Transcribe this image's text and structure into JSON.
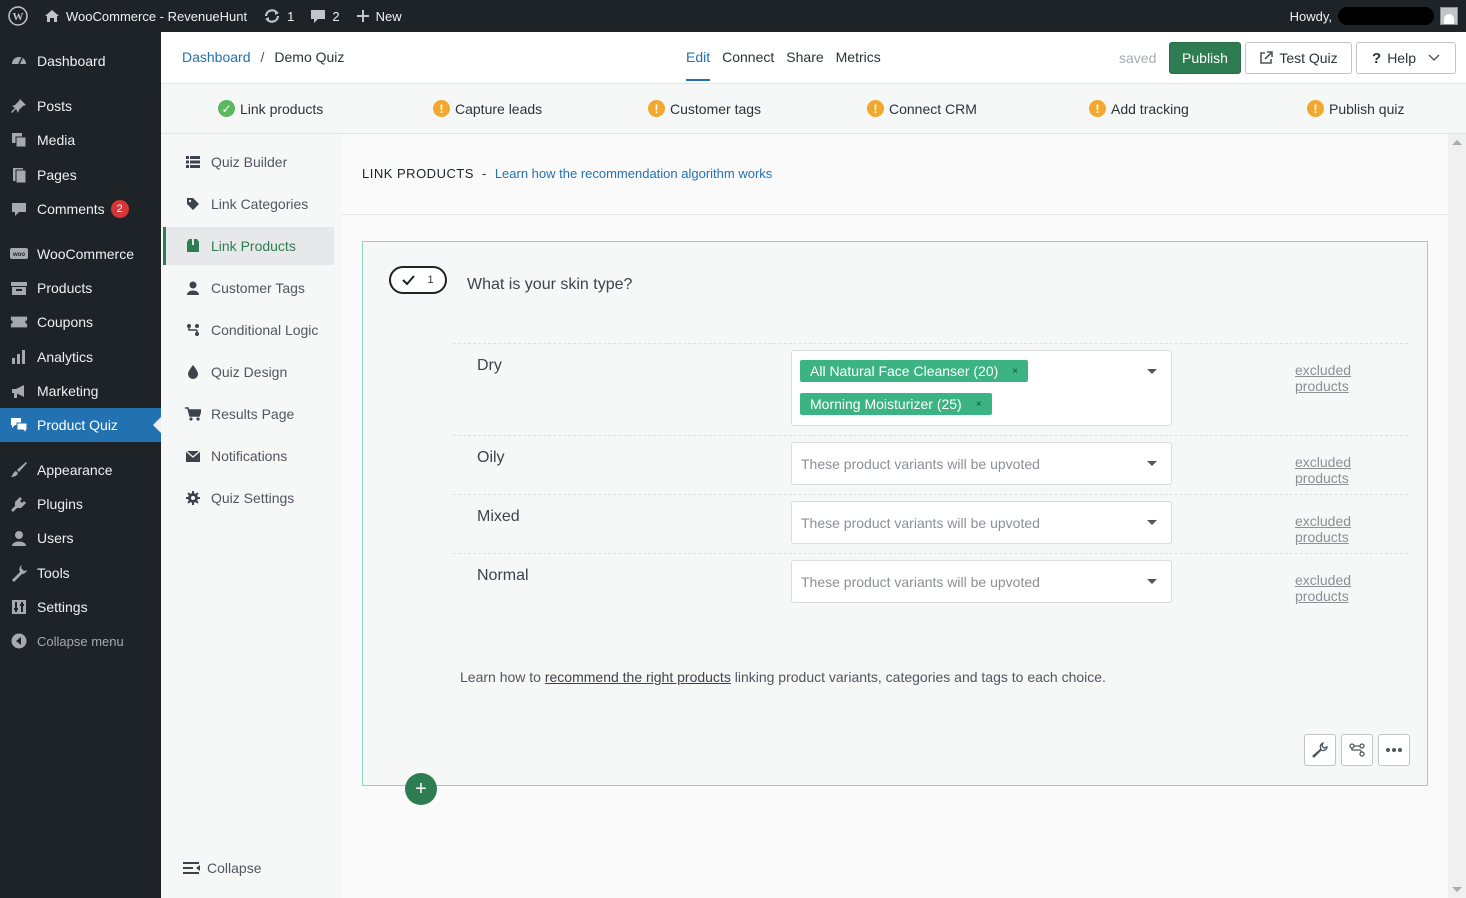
{
  "adminbar": {
    "site_name": "WooCommerce - RevenueHunt",
    "updates_count": "1",
    "comments_count": "2",
    "new_label": "New",
    "howdy": "Howdy,"
  },
  "menu": {
    "items": [
      {
        "label": "Dashboard",
        "icon": "dashboard-icon"
      },
      {
        "label": "Posts",
        "icon": "pin-icon"
      },
      {
        "label": "Media",
        "icon": "media-icon"
      },
      {
        "label": "Pages",
        "icon": "pages-icon"
      },
      {
        "label": "Comments",
        "icon": "comment-icon",
        "badge": "2"
      },
      {
        "label": "WooCommerce",
        "icon": "woo-icon"
      },
      {
        "label": "Products",
        "icon": "archive-icon"
      },
      {
        "label": "Coupons",
        "icon": "ticket-icon"
      },
      {
        "label": "Analytics",
        "icon": "chart-icon"
      },
      {
        "label": "Marketing",
        "icon": "megaphone-icon"
      },
      {
        "label": "Product Quiz",
        "icon": "quiz-icon"
      },
      {
        "label": "Appearance",
        "icon": "brush-icon"
      },
      {
        "label": "Plugins",
        "icon": "plug-icon"
      },
      {
        "label": "Users",
        "icon": "user-icon"
      },
      {
        "label": "Tools",
        "icon": "wrench-icon"
      },
      {
        "label": "Settings",
        "icon": "settings-icon"
      },
      {
        "label": "Collapse menu",
        "icon": "collapse-icon"
      }
    ]
  },
  "header": {
    "breadcrumb_root": "Dashboard",
    "breadcrumb_sep": "/",
    "breadcrumb_current": "Demo Quiz",
    "tabs": [
      "Edit",
      "Connect",
      "Share",
      "Metrics"
    ],
    "saved": "saved",
    "publish": "Publish",
    "test_quiz": "Test Quiz",
    "help": "Help"
  },
  "steps": [
    {
      "label": "Link products",
      "status": "done"
    },
    {
      "label": "Capture leads",
      "status": "warning"
    },
    {
      "label": "Customer tags",
      "status": "warning"
    },
    {
      "label": "Connect CRM",
      "status": "warning"
    },
    {
      "label": "Add tracking",
      "status": "warning"
    },
    {
      "label": "Publish quiz",
      "status": "warning"
    }
  ],
  "subnav": {
    "items": [
      {
        "label": "Quiz Builder",
        "icon": "list-icon"
      },
      {
        "label": "Link Categories",
        "icon": "tag-icon"
      },
      {
        "label": "Link Products",
        "icon": "box-icon"
      },
      {
        "label": "Customer Tags",
        "icon": "user-icon"
      },
      {
        "label": "Conditional Logic",
        "icon": "branch-icon"
      },
      {
        "label": "Quiz Design",
        "icon": "drop-icon"
      },
      {
        "label": "Results Page",
        "icon": "cart-icon"
      },
      {
        "label": "Notifications",
        "icon": "envelope-icon"
      },
      {
        "label": "Quiz Settings",
        "icon": "gear-icon"
      }
    ],
    "collapse": "Collapse"
  },
  "main": {
    "section_title": "LINK PRODUCTS",
    "section_dash": "-",
    "learn_link": "Learn how the recommendation algorithm works",
    "question": {
      "number": "1",
      "text": "What is your skin type?"
    },
    "choices": [
      {
        "label": "Dry",
        "tags": [
          "All Natural Face Cleanser (20)",
          "Morning Moisturizer (25)"
        ],
        "placeholder": "",
        "excluded": "excluded products"
      },
      {
        "label": "Oily",
        "tags": [],
        "placeholder": "These product variants will be upvoted",
        "excluded": "excluded products"
      },
      {
        "label": "Mixed",
        "tags": [],
        "placeholder": "These product variants will be upvoted",
        "excluded": "excluded products"
      },
      {
        "label": "Normal",
        "tags": [],
        "placeholder": "These product variants will be upvoted",
        "excluded": "excluded products"
      }
    ],
    "help_prefix": "Learn how to",
    "help_link": "recommend the right products",
    "help_suffix": "linking product variants, categories and tags to each choice.",
    "tag_remove": "×",
    "add_label": "+"
  },
  "colors": {
    "accent_blue": "#2271b1",
    "accent_green": "#2e7d52",
    "tag_green": "#3cb383",
    "warning": "#f0a830",
    "ok": "#5cb85c"
  }
}
